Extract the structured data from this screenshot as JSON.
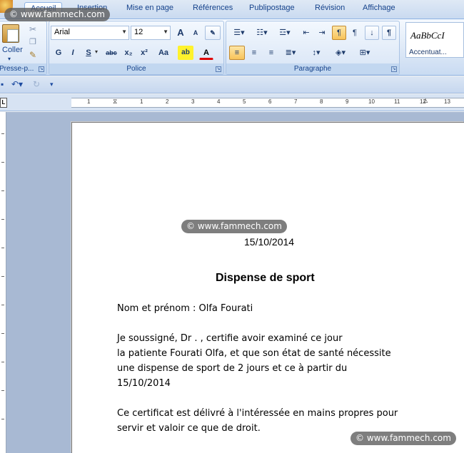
{
  "watermark": "© www.fammech.com",
  "tabs": [
    "Accueil",
    "Insertion",
    "Mise en page",
    "Références",
    "Publipostage",
    "Révision",
    "Affichage"
  ],
  "clipboard": {
    "paste_label": "Coller",
    "group_label": "Presse-p..."
  },
  "font": {
    "group_label": "Police",
    "name": "Arial",
    "size": "12",
    "grow_label": "A",
    "shrink_label": "A",
    "bold": "G",
    "italic": "I",
    "underline": "S",
    "strike": "abc",
    "subscript": "x₂",
    "superscript": "x²",
    "change_case": "Aa",
    "highlight": "ab",
    "color": "A"
  },
  "paragraph": {
    "group_label": "Paragraphe"
  },
  "styles": {
    "sample": "AaBbCcI",
    "name": "Accentuat..."
  },
  "ruler_numbers": [
    "1",
    "1",
    "2",
    "3",
    "4",
    "5",
    "6",
    "7",
    "8",
    "9",
    "10",
    "11",
    "12",
    "13"
  ],
  "document": {
    "date": "15/10/2014",
    "title": "Dispense de sport",
    "name_line": "Nom et prénom : Olfa Fourati",
    "body_lines": [
      "Je soussigné, Dr .                     , certifie avoir examiné ce jour",
      "la patiente Fourati Olfa,  et que son état de santé nécessite",
      "une dispense de sport de  2 jours et ce à partir du",
      "15/10/2014"
    ],
    "closing_lines": [
      "Ce certificat est délivré à l'intéressée en mains propres pour",
      "servir et valoir ce que de droit."
    ]
  },
  "colors": {
    "accent": "#15428b",
    "ribbon": "#dbe7f6",
    "doc_background": "#a8b9d3"
  }
}
